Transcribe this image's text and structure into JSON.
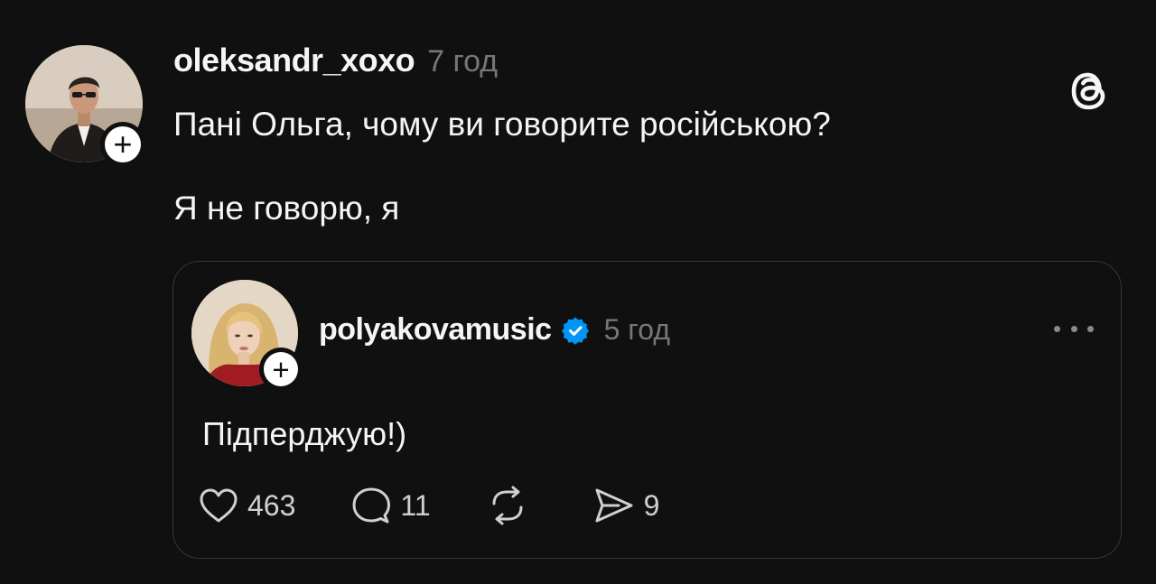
{
  "post": {
    "username": "oleksandr_xoxo",
    "time": "7 год",
    "follow_symbol": "+",
    "lines": [
      "Пані Ольга, чому ви говорите російською?",
      "Я не говорю, я"
    ]
  },
  "quoted_post": {
    "username": "polyakovamusic",
    "time": "5 год",
    "follow_symbol": "+",
    "text": "Підперджую!)",
    "verified": true,
    "actions": {
      "likes": "463",
      "replies": "11",
      "reposts": "",
      "shares": "9"
    }
  },
  "colors": {
    "background": "#101010",
    "text": "#f3f5f7",
    "secondary": "#777777",
    "verified_blue": "#0095f6",
    "card_border": "#333638"
  },
  "icons": {
    "header_logo": "threads-logo-icon",
    "like": "heart-icon",
    "reply": "comment-icon",
    "repost": "repost-icon",
    "share": "send-icon",
    "more": "more-dots-icon",
    "verified": "verified-badge-icon"
  }
}
